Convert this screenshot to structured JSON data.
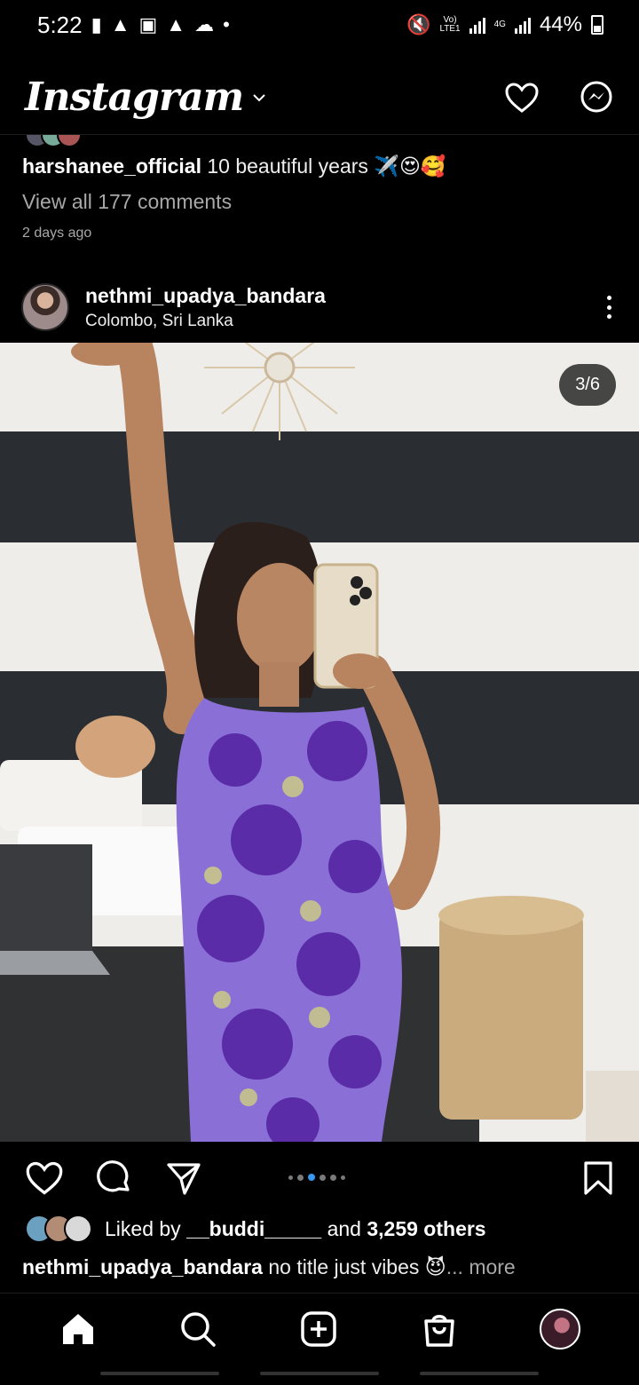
{
  "status_bar": {
    "time": "5:22",
    "network_top": "Vo)",
    "network_bottom": "LTE1",
    "net_type": "4G",
    "battery_pct": "44%"
  },
  "header": {
    "logo_text": "Instagram"
  },
  "previous_post": {
    "caption_user": "harshanee_official",
    "caption_text": " 10 beautiful years ✈️😍🥰",
    "view_comments": "View all 177 comments",
    "posted_time": "2 days ago"
  },
  "post": {
    "username": "nethmi_upadya_bandara",
    "location": "Colombo, Sri Lanka",
    "image_counter": "3/6",
    "carousel_index": 3,
    "carousel_total": 6,
    "likes_prefix": "Liked by ",
    "liked_by_user": "__buddi_____",
    "likes_mid": " and ",
    "likes_count": "3,259 others",
    "caption_user": "nethmi_upadya_bandara",
    "caption_text": " no title just vibes 😈",
    "caption_more": "... more"
  },
  "colors": {
    "background": "#000000",
    "carousel_active": "#3897f0",
    "secondary_text": "#a8a8a8"
  },
  "icons": {
    "header": [
      "heart-icon",
      "messenger-icon"
    ],
    "post_actions": [
      "heart-icon",
      "comment-icon",
      "share-icon",
      "bookmark-icon"
    ],
    "bottom_nav": [
      "home-icon",
      "search-icon",
      "add-icon",
      "shop-icon",
      "profile-avatar"
    ]
  }
}
